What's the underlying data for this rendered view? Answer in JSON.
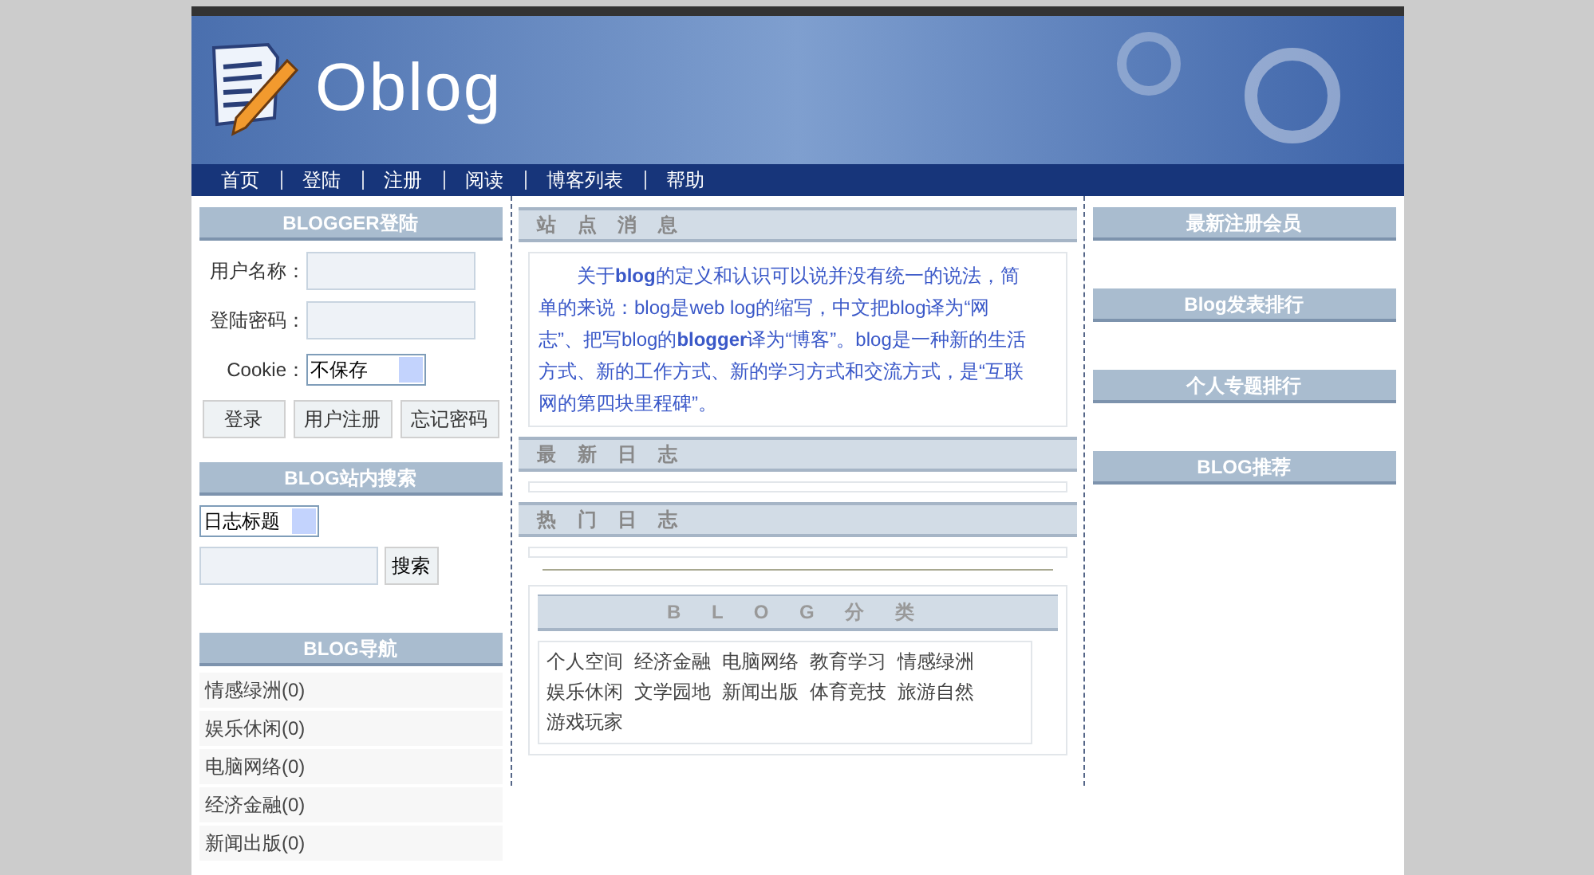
{
  "header": {
    "logo": "Oblog"
  },
  "nav": [
    "首页",
    "登陆",
    "注册",
    "阅读",
    "博客列表",
    "帮助"
  ],
  "login": {
    "title": "BLOGGER登陆",
    "fields": [
      {
        "label": "用户名称：",
        "kind": "text"
      },
      {
        "label": "登陆密码：",
        "kind": "password"
      },
      {
        "label": "Cookie：",
        "kind": "select",
        "value": "不保存"
      }
    ],
    "buttons": [
      "登录",
      "用户注册",
      "忘记密码"
    ]
  },
  "search": {
    "title": "BLOG站内搜索",
    "select": "日志标题",
    "button": "搜索"
  },
  "blog_nav": {
    "title": "BLOG导航",
    "items": [
      "情感绿洲(0)",
      "娱乐休闲(0)",
      "电脑网络(0)",
      "经济金融(0)",
      "新闻出版(0)"
    ]
  },
  "center": {
    "notice_title": "站 点 消 息",
    "notice": "关于**blog**的定义和认识可以说并没有统一的说法，简单的来说：blog是web log的缩写，中文把blog译为“网志”、把写blog的**blogger**译为“博客”。blog是一种新的生活方式、新的工作方式、新的学习方式和交流方式，是“互联网的第四块里程碑”。",
    "latest_title": "最 新 日 志",
    "hot_title": "热 门 日 志",
    "category_title": "B L O G 分 类",
    "categories": [
      "个人空间",
      "经济金融",
      "电脑网络",
      "教育学习",
      "情感绿洲",
      "娱乐休闲",
      "文学园地",
      "新闻出版",
      "体育竞技",
      "旅游自然",
      "游戏玩家"
    ]
  },
  "right": [
    "最新注册会员",
    "Blog发表排行",
    "个人专题排行",
    "BLOG推荐"
  ]
}
